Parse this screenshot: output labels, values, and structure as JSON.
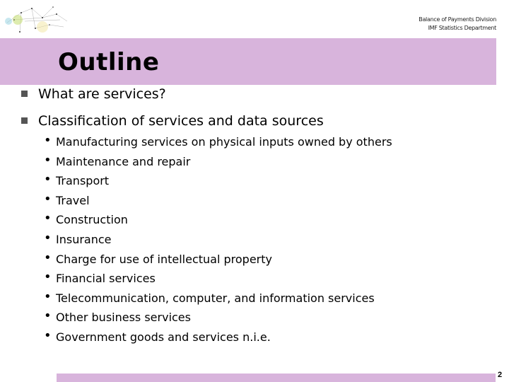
{
  "header": {
    "org_line1": "Balance of Payments Division",
    "org_line2": "IMF Statistics Department"
  },
  "slide": {
    "title": "Outline",
    "items": [
      {
        "label": "What are services?"
      },
      {
        "label": "Classification of services and data sources",
        "subitems": [
          "Manufacturing services on physical inputs owned by others",
          "Maintenance and repair",
          "Transport",
          "Travel",
          "Construction",
          "Insurance",
          "Charge for use of intellectual property",
          "Financial services",
          "Telecommunication, computer, and information services",
          "Other business services",
          "Government goods and services n.i.e."
        ]
      }
    ],
    "sub_bullet": "•",
    "page_number": "2"
  },
  "colors": {
    "accent": "#d8b4dc"
  }
}
